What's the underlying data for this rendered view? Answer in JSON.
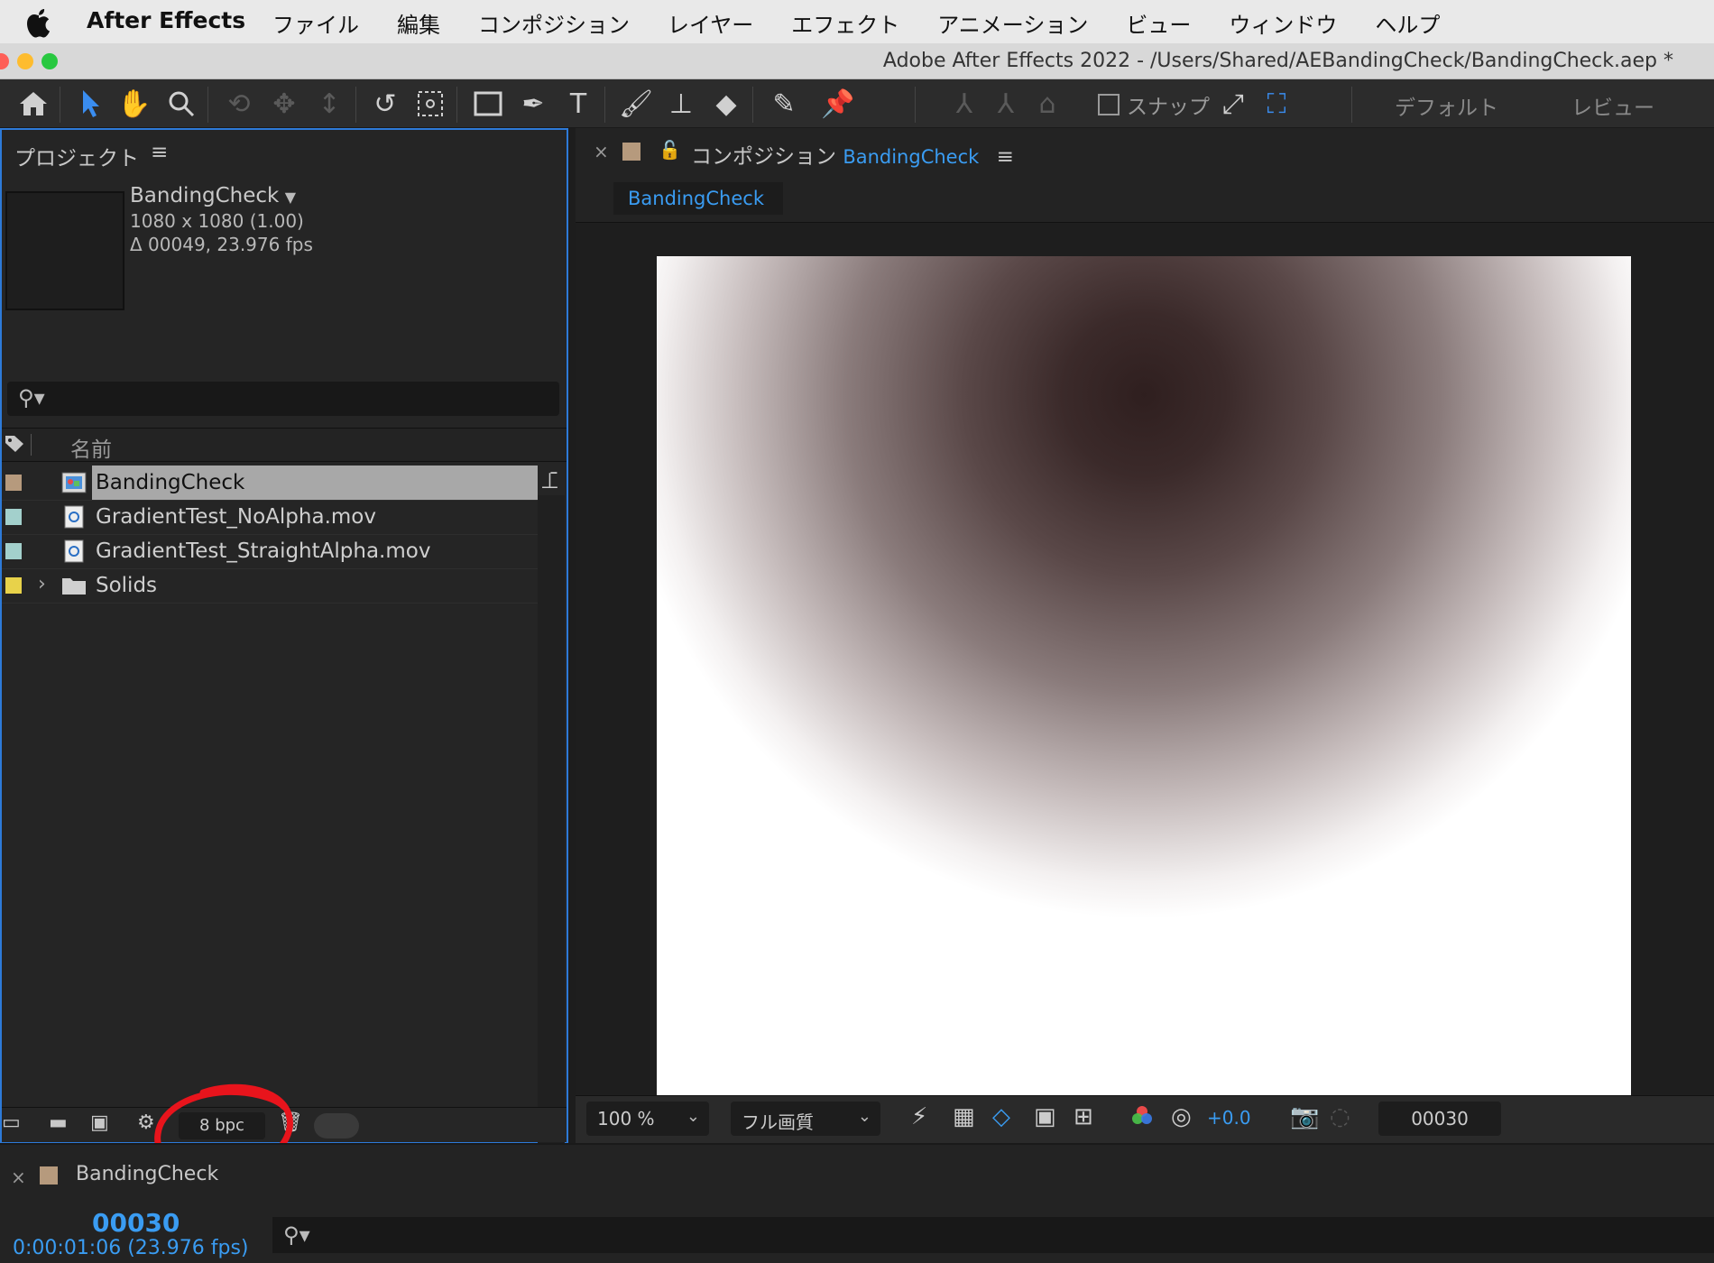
{
  "menubar": {
    "app_name": "After Effects",
    "items": [
      "ファイル",
      "編集",
      "コンポジション",
      "レイヤー",
      "エフェクト",
      "アニメーション",
      "ビュー",
      "ウィンドウ",
      "ヘルプ"
    ]
  },
  "window": {
    "title": "Adobe After Effects 2022 - /Users/Shared/AEBandingCheck/BandingCheck.aep *"
  },
  "toolbar": {
    "snap_label": "スナップ",
    "workspace_default": "デフォルト",
    "workspace_review": "レビュー"
  },
  "project": {
    "panel_title": "プロジェクト",
    "menu_glyph": "≡",
    "selected": {
      "name": "BandingCheck",
      "dimensions": "1080 x 1080 (1.00)",
      "duration": "Δ 00049, 23.976 fps"
    },
    "column_name": "名前",
    "items": [
      {
        "name": "BandingCheck",
        "type": "composition",
        "color": "#b69a7d",
        "selected": true
      },
      {
        "name": "GradientTest_NoAlpha.mov",
        "type": "footage",
        "color": "#a3d0cc"
      },
      {
        "name": "GradientTest_StraightAlpha.mov",
        "type": "footage",
        "color": "#a3d0cc"
      },
      {
        "name": "Solids",
        "type": "folder",
        "color": "#e8d24a"
      }
    ],
    "bit_depth": "8 bpc"
  },
  "composition": {
    "tab_prefix": "コンポジション",
    "tab_name": "BandingCheck",
    "subtab": "BandingCheck",
    "zoom": "100 %",
    "quality": "フル画質",
    "exposure": "+0.0",
    "frame": "00030"
  },
  "timeline": {
    "comp_name": "BandingCheck",
    "frame": "00030",
    "timecode": "0:00:01:06 (23.976 fps)"
  },
  "colors": {
    "accent": "#3a9cf2",
    "annotation": "#e8141c",
    "panel_focus": "#2d7ad8"
  }
}
